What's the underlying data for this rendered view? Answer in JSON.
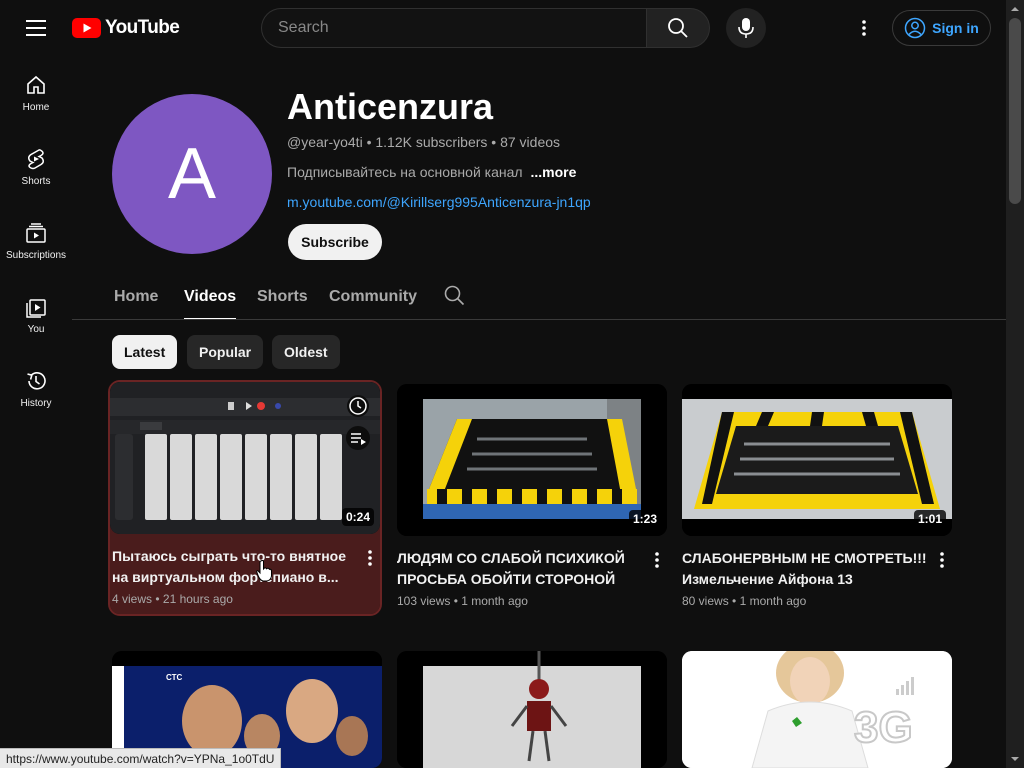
{
  "header": {
    "logo_text": "YouTube",
    "search_placeholder": "Search",
    "signin_label": "Sign in"
  },
  "sidebar": {
    "items": [
      {
        "label": "Home",
        "icon": "home-icon"
      },
      {
        "label": "Shorts",
        "icon": "shorts-icon"
      },
      {
        "label": "Subscriptions",
        "icon": "subscriptions-icon"
      },
      {
        "label": "You",
        "icon": "you-icon"
      },
      {
        "label": "History",
        "icon": "history-icon"
      }
    ]
  },
  "channel": {
    "avatar_letter": "A",
    "name": "Anticenzura",
    "meta": "@year-yo4ti • 1.12K subscribers • 87 videos",
    "description": "Подписывайтесь на основной канал",
    "more_label": "...more",
    "link": "m.youtube.com/@Kirillserg995Anticenzura-jn1qp",
    "subscribe_label": "Subscribe"
  },
  "tabs": [
    "Home",
    "Videos",
    "Shorts",
    "Community"
  ],
  "active_tab": "Videos",
  "chips": [
    "Latest",
    "Popular",
    "Oldest"
  ],
  "selected_chip": "Latest",
  "videos": [
    {
      "title": "Пытаюсь сыграть что-то внятное на виртуальном фортепиано в...",
      "duration": "0:24",
      "views": "4 views",
      "age": "21 hours ago"
    },
    {
      "title": "ЛЮДЯМ СО СЛАБОЙ ПСИХИКОЙ ПРОСЬБА ОБОЙТИ СТОРОНОЙ ЭТО...",
      "duration": "1:23",
      "views": "103 views",
      "age": "1 month ago"
    },
    {
      "title": "СЛАБОНЕРВНЫМ НЕ СМОТРЕТЬ!!! Измельчение Айфона 13",
      "duration": "1:01",
      "views": "80 views",
      "age": "1 month ago"
    }
  ],
  "second_row": {
    "thumb_labels": [
      "СТС",
      "3G"
    ]
  },
  "status_url": "https://www.youtube.com/watch?v=YPNa_1o0TdU",
  "colors": {
    "background": "#0f0f0f",
    "avatar": "#7e57c2",
    "link": "#3ea6ff",
    "logo_red": "#ff0000",
    "hover_card": "#4a1c1c"
  }
}
